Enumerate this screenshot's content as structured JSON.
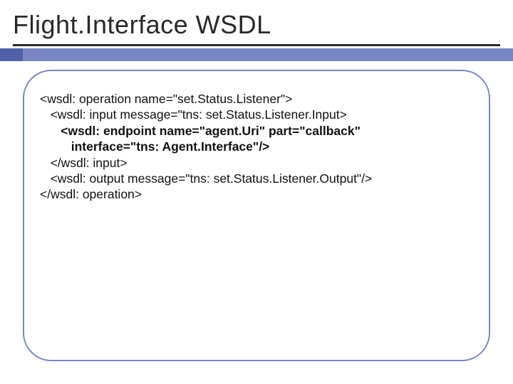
{
  "slide": {
    "title": "Flight.Interface WSDL"
  },
  "code": {
    "l1": "<wsdl: operation name=\"set.Status.Listener\">",
    "l2": "   <wsdl: input message=\"tns: set.Status.Listener.Input>",
    "l3": "      <wsdl: endpoint name=\"agent.Uri\" part=\"callback\"",
    "l4": "         interface=\"tns: Agent.Interface\"/>",
    "l5": "   </wsdl: input>",
    "l6": "   <wsdl: output message=\"tns: set.Status.Listener.Output\"/>",
    "l7": "</wsdl: operation>"
  }
}
